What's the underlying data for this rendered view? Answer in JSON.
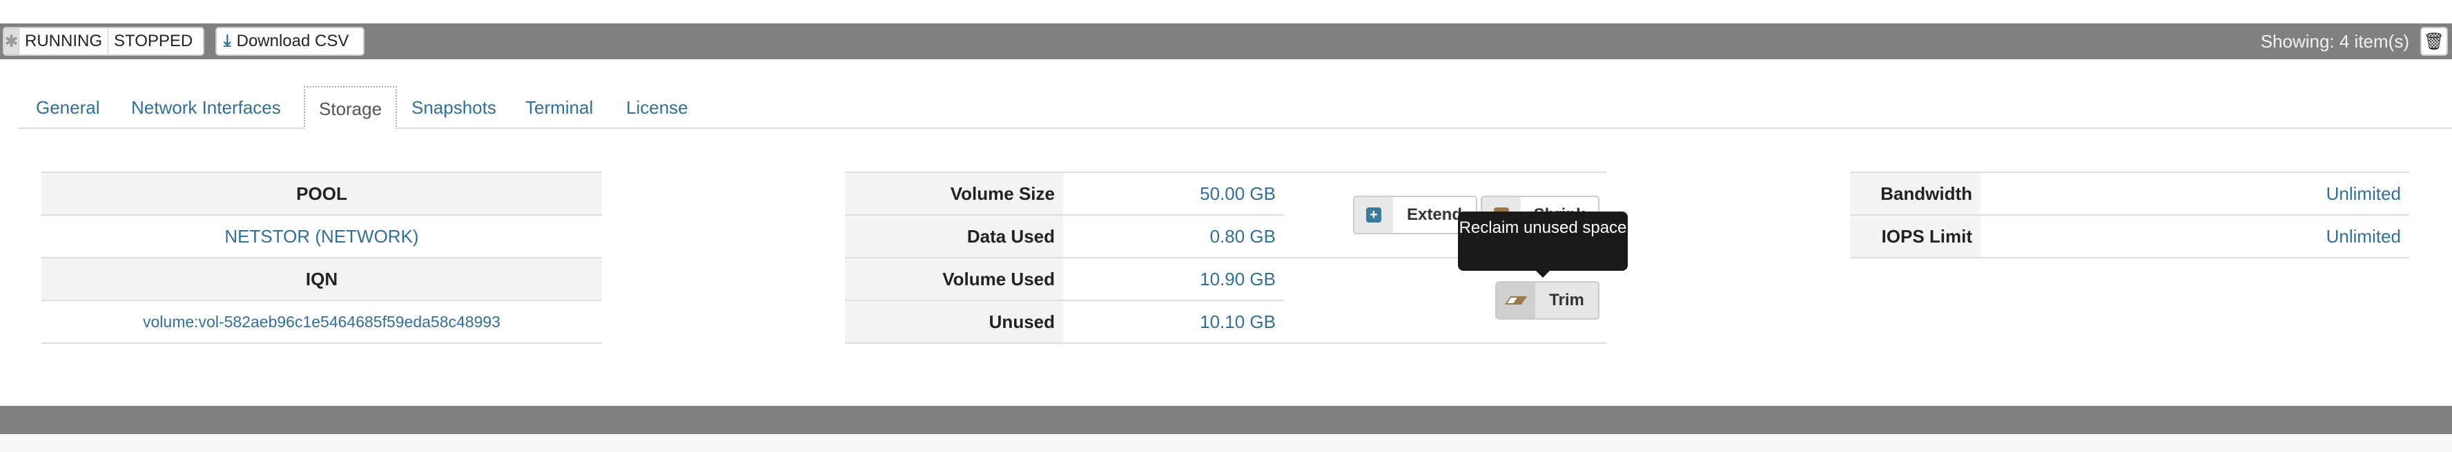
{
  "toolbar": {
    "filters": [
      "RUNNING",
      "STOPPED"
    ],
    "download_label": "Download CSV",
    "showing": "Showing: 4 item(s)"
  },
  "tabs": [
    {
      "label": "General"
    },
    {
      "label": "Network Interfaces"
    },
    {
      "label": "Storage",
      "active": true
    },
    {
      "label": "Snapshots"
    },
    {
      "label": "Terminal"
    },
    {
      "label": "License"
    }
  ],
  "pool": {
    "pool_header": "POOL",
    "pool_value": "NETSTOR (NETWORK)",
    "iqn_header": "IQN",
    "iqn_value": "volume:vol-582aeb96c1e5464685f59eda58c48993"
  },
  "volume": {
    "rows": [
      {
        "label": "Volume Size",
        "value": "50.00 GB"
      },
      {
        "label": "Data Used",
        "value": "0.80 GB"
      },
      {
        "label": "Volume Used",
        "value": "10.90 GB"
      },
      {
        "label": "Unused",
        "value": "10.10 GB"
      }
    ]
  },
  "actions": {
    "extend": "Extend",
    "shrink": "Shrink",
    "trim": "Trim",
    "tooltip": "Reclaim unused space"
  },
  "limits": {
    "rows": [
      {
        "label": "Bandwidth",
        "value": "Unlimited"
      },
      {
        "label": "IOPS Limit",
        "value": "Unlimited"
      }
    ]
  },
  "colors": {
    "link": "#336e95",
    "bar": "#808080",
    "extend_icon": "#3a7a9c",
    "shrink_icon": "#9a7a48"
  }
}
